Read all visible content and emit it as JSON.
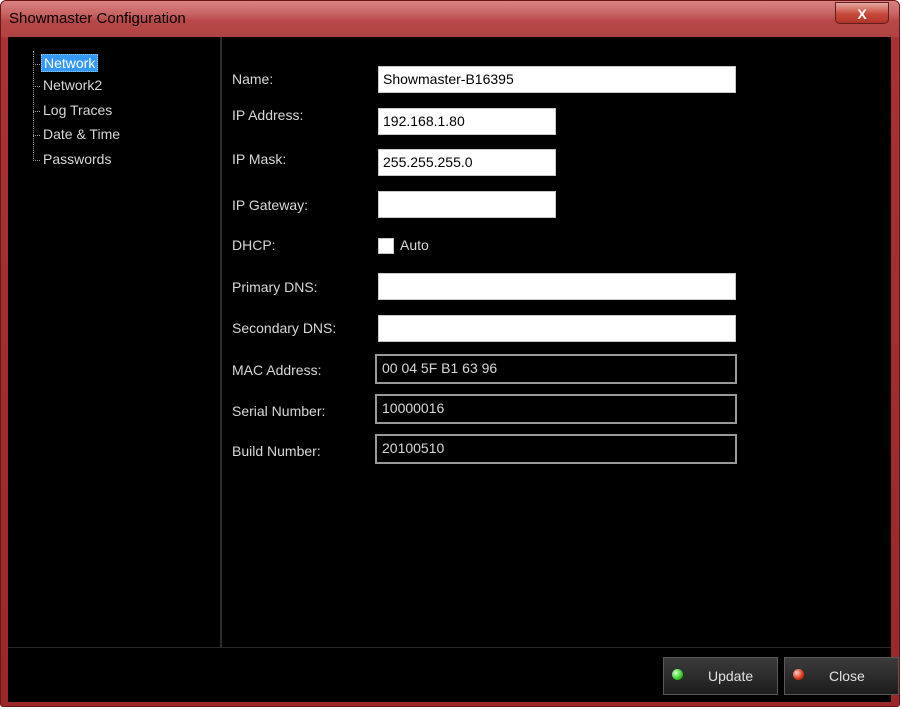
{
  "window": {
    "title": "Showmaster Configuration",
    "close_glyph": "X"
  },
  "tree": {
    "items": [
      {
        "label": "Network",
        "selected": true
      },
      {
        "label": "Network2",
        "selected": false
      },
      {
        "label": "Log Traces",
        "selected": false
      },
      {
        "label": "Date & Time",
        "selected": false
      },
      {
        "label": "Passwords",
        "selected": false
      }
    ]
  },
  "form": {
    "name_label": "Name:",
    "name_value": "Showmaster-B16395",
    "ip_address_label": "IP Address:",
    "ip_address_value": "192.168.1.80",
    "ip_mask_label": "IP Mask:",
    "ip_mask_value": "255.255.255.0",
    "ip_gateway_label": "IP Gateway:",
    "ip_gateway_value": "",
    "dhcp_label": "DHCP:",
    "dhcp_checkbox_label": "Auto",
    "dhcp_checked": false,
    "primary_dns_label": "Primary DNS:",
    "primary_dns_value": "",
    "secondary_dns_label": "Secondary DNS:",
    "secondary_dns_value": "",
    "mac_label": "MAC Address:",
    "mac_value": "00 04 5F B1 63 96",
    "serial_label": "Serial Number:",
    "serial_value": "10000016",
    "build_label": "Build Number:",
    "build_value": "20100510"
  },
  "buttons": {
    "update_label": "Update",
    "update_led_color": "#3ad12a",
    "close_label": "Close",
    "close_led_color": "#e23a22"
  },
  "colors": {
    "frame_red": "#b04242",
    "background": "#000000",
    "selection": "#3399ff"
  }
}
